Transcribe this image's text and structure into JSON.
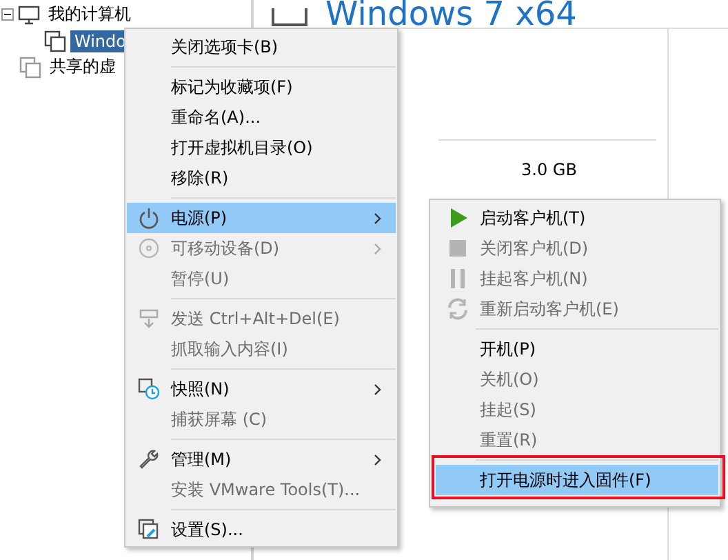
{
  "library": {
    "items": [
      {
        "label": "我的计算机",
        "expanded": true,
        "selected": false,
        "children": [
          {
            "label": "Windo",
            "selected": true
          }
        ]
      },
      {
        "label": "共享的虚",
        "selected": false
      }
    ]
  },
  "vm_view": {
    "title": "Windows 7 x64",
    "memory": "3.0 GB"
  },
  "context_menu": {
    "items": [
      {
        "kind": "item",
        "label": "关闭选项卡(B)",
        "disabled": false,
        "selected": false,
        "has_submenu": false
      },
      {
        "kind": "separator"
      },
      {
        "kind": "item",
        "label": "标记为收藏项(F)",
        "disabled": false,
        "selected": false,
        "has_submenu": false
      },
      {
        "kind": "item",
        "label": "重命名(A)...",
        "disabled": false,
        "selected": false,
        "has_submenu": false
      },
      {
        "kind": "item",
        "label": "打开虚拟机目录(O)",
        "disabled": false,
        "selected": false,
        "has_submenu": false
      },
      {
        "kind": "item",
        "label": "移除(R)",
        "disabled": false,
        "selected": false,
        "has_submenu": false
      },
      {
        "kind": "separator"
      },
      {
        "kind": "item",
        "label": "电源(P)",
        "disabled": false,
        "selected": true,
        "has_submenu": true
      },
      {
        "kind": "item",
        "label": "可移动设备(D)",
        "disabled": true,
        "selected": false,
        "has_submenu": true
      },
      {
        "kind": "item",
        "label": "暂停(U)",
        "disabled": true,
        "selected": false,
        "has_submenu": false
      },
      {
        "kind": "separator"
      },
      {
        "kind": "item",
        "label": "发送 Ctrl+Alt+Del(E)",
        "disabled": true,
        "selected": false,
        "has_submenu": false
      },
      {
        "kind": "item",
        "label": "抓取输入内容(I)",
        "disabled": true,
        "selected": false,
        "has_submenu": false
      },
      {
        "kind": "separator"
      },
      {
        "kind": "item",
        "label": "快照(N)",
        "disabled": false,
        "selected": false,
        "has_submenu": true
      },
      {
        "kind": "item",
        "label": "捕获屏幕 (C)",
        "disabled": true,
        "selected": false,
        "has_submenu": false
      },
      {
        "kind": "separator"
      },
      {
        "kind": "item",
        "label": "管理(M)",
        "disabled": false,
        "selected": false,
        "has_submenu": true
      },
      {
        "kind": "item",
        "label": "安装 VMware Tools(T)...",
        "disabled": true,
        "selected": false,
        "has_submenu": false
      },
      {
        "kind": "separator"
      },
      {
        "kind": "item",
        "label": "设置(S)...",
        "disabled": false,
        "selected": false,
        "has_submenu": false
      }
    ]
  },
  "power_submenu": {
    "items": [
      {
        "kind": "item",
        "label": "启动客户机(T)",
        "disabled": false,
        "selected": false,
        "outlined": false
      },
      {
        "kind": "item",
        "label": "关闭客户机(D)",
        "disabled": true,
        "selected": false,
        "outlined": false
      },
      {
        "kind": "item",
        "label": "挂起客户机(N)",
        "disabled": true,
        "selected": false,
        "outlined": false
      },
      {
        "kind": "item",
        "label": "重新启动客户机(E)",
        "disabled": true,
        "selected": false,
        "outlined": false
      },
      {
        "kind": "separator"
      },
      {
        "kind": "item",
        "label": "开机(P)",
        "disabled": false,
        "selected": false,
        "outlined": false
      },
      {
        "kind": "item",
        "label": "关机(O)",
        "disabled": true,
        "selected": false,
        "outlined": false
      },
      {
        "kind": "item",
        "label": "挂起(S)",
        "disabled": true,
        "selected": false,
        "outlined": false
      },
      {
        "kind": "item",
        "label": "重置(R)",
        "disabled": true,
        "selected": false,
        "outlined": false
      },
      {
        "kind": "separator"
      },
      {
        "kind": "item",
        "label": "打开电源时进入固件(F)",
        "disabled": false,
        "selected": true,
        "outlined": true
      }
    ]
  }
}
